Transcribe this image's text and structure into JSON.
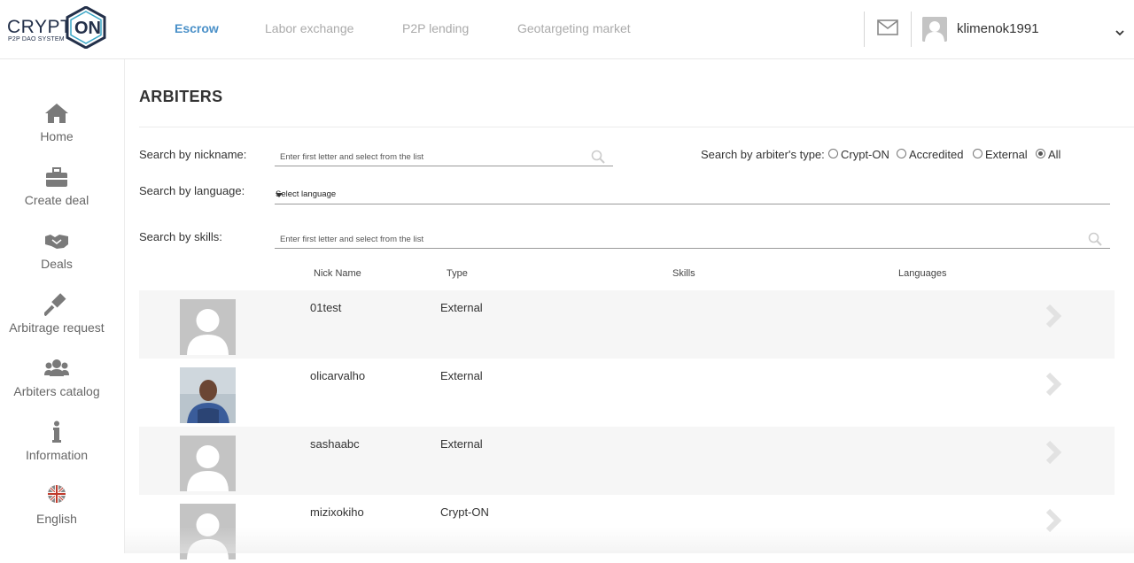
{
  "logo": {
    "word": "CRYPT",
    "on": "ON",
    "tagline": "P2P DAO SYSTEM"
  },
  "topnav": [
    {
      "label": "Escrow",
      "active": true
    },
    {
      "label": "Labor exchange",
      "active": false
    },
    {
      "label": "P2P lending",
      "active": false
    },
    {
      "label": "Geotargeting market",
      "active": false
    }
  ],
  "user": {
    "name": "klimenok1991"
  },
  "sidebar": {
    "items": [
      {
        "label": "Home",
        "icon": "home-icon"
      },
      {
        "label": "Create deal",
        "icon": "briefcase-icon"
      },
      {
        "label": "Deals",
        "icon": "handshake-icon"
      },
      {
        "label": "Arbitrage request",
        "icon": "gavel-icon"
      },
      {
        "label": "Arbiters catalog",
        "icon": "users-icon"
      },
      {
        "label": "Information",
        "icon": "info-icon"
      },
      {
        "label": "English",
        "icon": "uk-flag-icon"
      }
    ]
  },
  "page": {
    "title": "ARBITERS"
  },
  "filters": {
    "nickname": {
      "label": "Search by nickname:",
      "placeholder": "Enter first letter and select from the list"
    },
    "language": {
      "label": "Search by language:",
      "value": "Select language"
    },
    "skills": {
      "label": "Search by skills:",
      "placeholder": "Enter first letter and select from the list"
    },
    "type": {
      "label": "Search by arbiter's type:",
      "options": [
        {
          "label": "Crypt-ON",
          "checked": false
        },
        {
          "label": "Accredited",
          "checked": false
        },
        {
          "label": "External",
          "checked": false
        },
        {
          "label": "All",
          "checked": true
        }
      ]
    }
  },
  "table": {
    "columns": [
      "Nick Name",
      "Type",
      "Skills",
      "Languages"
    ],
    "rows": [
      {
        "nick": "01test",
        "type": "External",
        "photo": false
      },
      {
        "nick": "olicarvalho",
        "type": "External",
        "photo": true
      },
      {
        "nick": "sashaabc",
        "type": "External",
        "photo": false
      },
      {
        "nick": "mizixokiho",
        "type": "Crypt-ON",
        "photo": false
      }
    ]
  },
  "colors": {
    "accent": "#4a90c8",
    "muted": "#aaaaaa",
    "row_bg": "#f6f6f6"
  }
}
